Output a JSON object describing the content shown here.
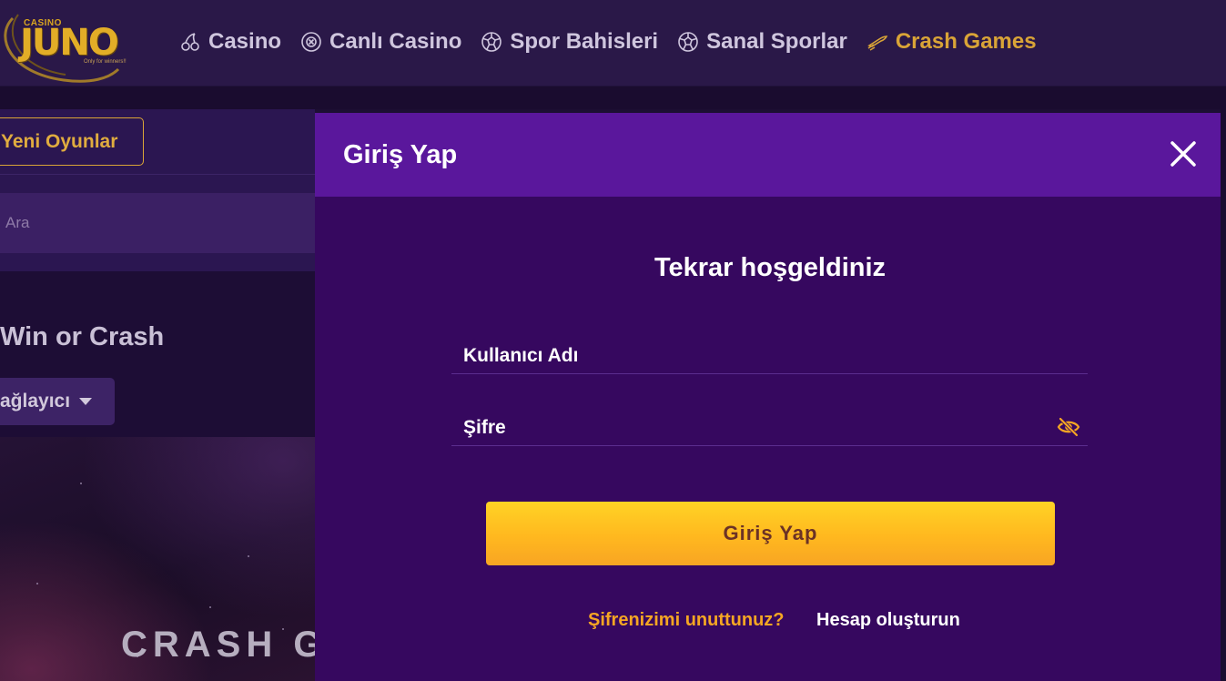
{
  "brand": {
    "top_text": "CASINO",
    "name": "JUNO",
    "tagline": "Only for winners!!",
    "color": "#e2ad27"
  },
  "nav": {
    "items": [
      {
        "label": "Casino",
        "icon": "cherry-icon",
        "active": false
      },
      {
        "label": "Canlı Casino",
        "icon": "casino-chip-icon",
        "active": false
      },
      {
        "label": "Spor Bahisleri",
        "icon": "soccer-ball-icon",
        "active": false
      },
      {
        "label": "Sanal Sporlar",
        "icon": "soccer-ball-icon",
        "active": false
      },
      {
        "label": "Crash Games",
        "icon": "rocket-icon",
        "active": true
      }
    ],
    "active_color": "#d9a437",
    "inactive_color": "#cfc6de"
  },
  "background_page": {
    "new_games_label": "Yeni Oyunlar",
    "search_placeholder": "Ara",
    "game_title": "Win or Crash",
    "provider_label": "ağlayıcı",
    "banner_text": "CRASH G"
  },
  "modal": {
    "title": "Giriş Yap",
    "welcome": "Tekrar hoşgeldiniz",
    "username_placeholder": "Kullanıcı Adı",
    "password_placeholder": "Şifre",
    "submit_label": "Giriş Yap",
    "forgot_label": "Şifrenizimi unuttunuz?",
    "register_label": "Hesap oluşturun",
    "header_color": "#5a179c",
    "body_color": "#36085f",
    "accent_color": "#f5a623"
  }
}
